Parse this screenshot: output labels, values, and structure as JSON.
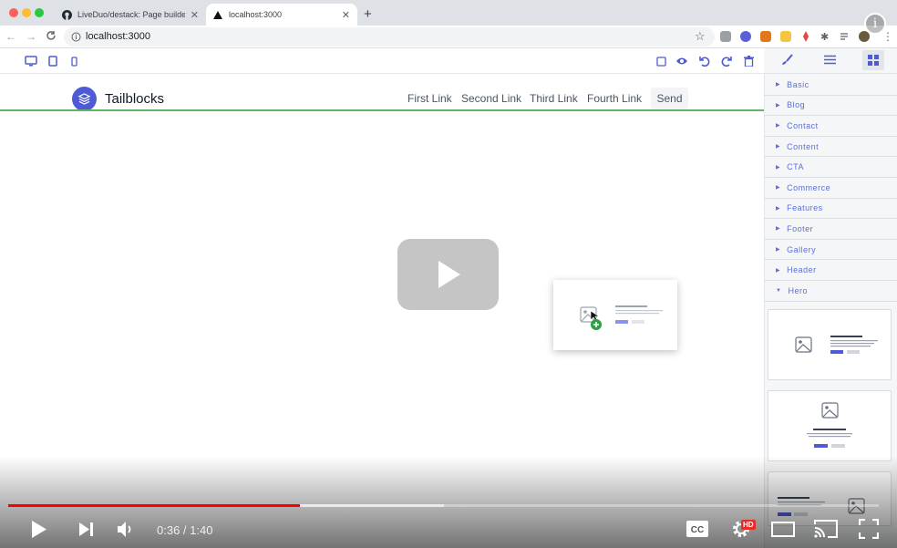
{
  "browser": {
    "tabs": [
      {
        "title": "LiveDuo/destack: Page builder",
        "active": false
      },
      {
        "title": "localhost:3000",
        "active": true
      }
    ],
    "new_tab": "+",
    "address": "localhost:3000"
  },
  "site": {
    "brand": "Tailblocks",
    "links": [
      "First Link",
      "Second Link",
      "Third Link",
      "Fourth Link"
    ],
    "cta": "Send"
  },
  "panel": {
    "categories": [
      {
        "label": "Basic",
        "expanded": false
      },
      {
        "label": "Blog",
        "expanded": false
      },
      {
        "label": "Contact",
        "expanded": false
      },
      {
        "label": "Content",
        "expanded": false
      },
      {
        "label": "CTA",
        "expanded": false
      },
      {
        "label": "Commerce",
        "expanded": false
      },
      {
        "label": "Features",
        "expanded": false
      },
      {
        "label": "Footer",
        "expanded": false
      },
      {
        "label": "Gallery",
        "expanded": false
      },
      {
        "label": "Header",
        "expanded": false
      },
      {
        "label": "Hero",
        "expanded": true
      }
    ]
  },
  "video": {
    "time": "0:36 / 1:40",
    "progress_fraction": 0.335,
    "buffered_fraction": 0.5,
    "hd_badge": "HD",
    "info": "i"
  },
  "colors": {
    "accent": "#4f5bd5",
    "progress": "#ff0000",
    "selection_line": "#63b36b"
  }
}
